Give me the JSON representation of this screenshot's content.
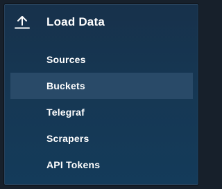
{
  "menu": {
    "header": {
      "title": "Load Data",
      "icon": "upload-icon"
    },
    "items": [
      {
        "label": "Sources",
        "active": false
      },
      {
        "label": "Buckets",
        "active": true
      },
      {
        "label": "Telegraf",
        "active": false
      },
      {
        "label": "Scrapers",
        "active": false
      },
      {
        "label": "API Tokens",
        "active": false
      }
    ]
  },
  "colors": {
    "panel_bg_top": "#17314b",
    "panel_bg_bottom": "#143b5a",
    "active_item_bg": "#294a68",
    "text": "#ffffff",
    "page_bg": "#17202b"
  }
}
